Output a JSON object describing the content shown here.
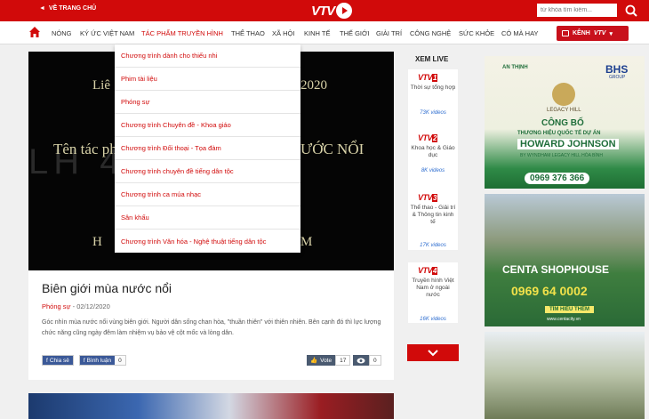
{
  "colors": {
    "brand_red": "#d10a0a",
    "link_blue": "#2f6ed0",
    "facebook": "#3b5998"
  },
  "topbar": {
    "home_label": "VỀ TRANG CHỦ",
    "logo_text": "VTV",
    "search_placeholder": "từ khóa tìm kiếm...",
    "search_icon": "search-icon"
  },
  "nav": {
    "home_icon": "home-icon",
    "items": [
      "NÓNG",
      "KÝ ỨC VIỆT NAM",
      "TÁC PHẨM TRUYỀN HÌNH",
      "THỂ THAO",
      "XÃ HỘI",
      "KINH TẾ",
      "THẾ GIỚI",
      "GIẢI TRÍ",
      "CÔNG NGHỆ",
      "SỨC KHỎE",
      "CÓ MÀ HAY"
    ],
    "active_index": 2,
    "channel_label": "KÊNH",
    "channel_logo": "VTV"
  },
  "dropdown": {
    "items": [
      "Chương trình dành cho thiếu nhi",
      "Phim tài liệu",
      "Phóng sự",
      "Chương trình Chuyên đề - Khoa giáo",
      "Chương trình Đối thoại - Tọa đàm",
      "Chương trình chuyên đề tiếng dân tộc",
      "Chương trình ca múa nhạc",
      "Sân khấu",
      "Chương trình Văn hóa - Nghệ thuật tiếng dân tộc"
    ]
  },
  "video": {
    "line1_left": "Liê",
    "line1_right": "2020",
    "line2_left": "Tên tác ph",
    "line2_right": "ƯỚC NỔI",
    "line3_left": "H",
    "line3_right": "M",
    "watermark": "LH 40"
  },
  "article": {
    "title": "Biên giới mùa nước nổi",
    "category": "Phóng sự",
    "date": " - 02/12/2020",
    "excerpt": "Góc nhìn mùa nước nổi vùng biên giới. Người dân sống chan hòa, \"thuần thiên\" với thiên nhiên. Bên cạnh đó thì lực lượng chức năng cũng ngày đêm làm nhiệm vụ bảo vệ cột mốc và lòng dân.",
    "share_label": "Chia sẻ",
    "comment_label": "Bình luận",
    "comment_count": "0",
    "vote_label": "Vote",
    "vote_count": "17",
    "view_count": "0"
  },
  "live": {
    "title": "XEM LIVE",
    "channels": [
      {
        "logo": "VTV",
        "num": "1",
        "desc": "Thời sự tổng hợp",
        "views": "73K videos"
      },
      {
        "logo": "VTV",
        "num": "2",
        "desc": "Khoa học & Giáo dục",
        "views": "8K videos"
      },
      {
        "logo": "VTV",
        "num": "3",
        "desc": "Thể thao - Giải trí & Thông tin kinh tế",
        "views": "17K videos"
      },
      {
        "logo": "VTV",
        "num": "4",
        "desc": "Truyền hình Việt Nam ở ngoài nước",
        "views": "16K videos"
      }
    ],
    "more_icon": "chevron-down-icon"
  },
  "ads": {
    "ad1": {
      "brand_left": "AN THỊNH",
      "brand_right": "BHS",
      "brand_right_sub": "GROUP",
      "project": "LEGACY HILL",
      "headline": "CÔNG BỐ",
      "sub": "THƯƠNG HIỆU QUỐC TẾ DỰ ÁN",
      "name": "HOWARD JOHNSON",
      "name_sub": "BY WYNDHAM LEGACY HILL HÒA BÌNH",
      "phone": "0969 376 366"
    },
    "ad2": {
      "brand": "CENTA SHOPHOUSE",
      "phone": "0969 64 0002",
      "cta": "TÌM HIỂU THÊM",
      "url": "www.centacity.vn"
    }
  }
}
